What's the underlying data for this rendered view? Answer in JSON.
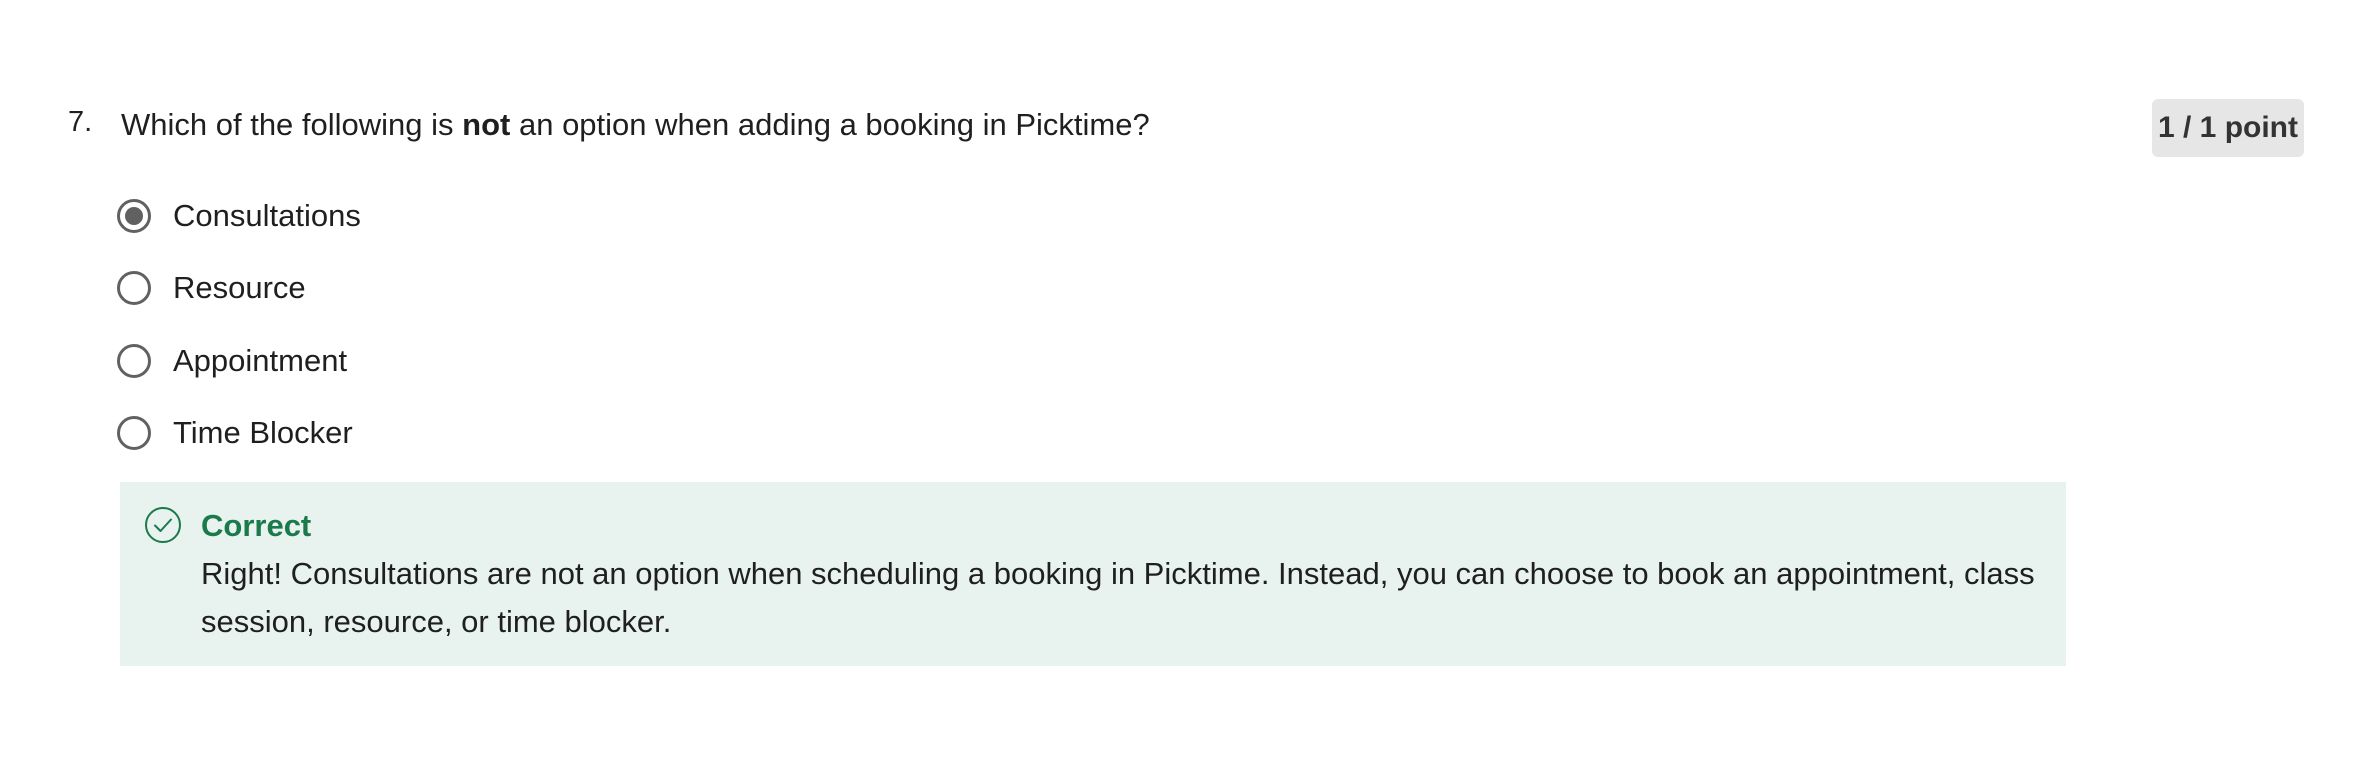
{
  "question": {
    "number": "7.",
    "text_before": "Which of the following is ",
    "text_bold": "not",
    "text_after": " an option when adding a booking in Picktime?",
    "points": "1 / 1 point"
  },
  "options": [
    {
      "label": "Consultations",
      "selected": true
    },
    {
      "label": "Resource",
      "selected": false
    },
    {
      "label": "Appointment",
      "selected": false
    },
    {
      "label": "Time Blocker",
      "selected": false
    }
  ],
  "feedback": {
    "icon": "check-circle-icon",
    "title": "Correct",
    "body": "Right! Consultations are not an option when scheduling a booking in Picktime. Instead, you can choose to book an appointment, class session, resource, or time blocker."
  },
  "colors": {
    "correct_green": "#1b7a4b",
    "feedback_bg": "#e8f2ef",
    "radio_gray": "#616161",
    "badge_bg": "#e6e6e6"
  }
}
